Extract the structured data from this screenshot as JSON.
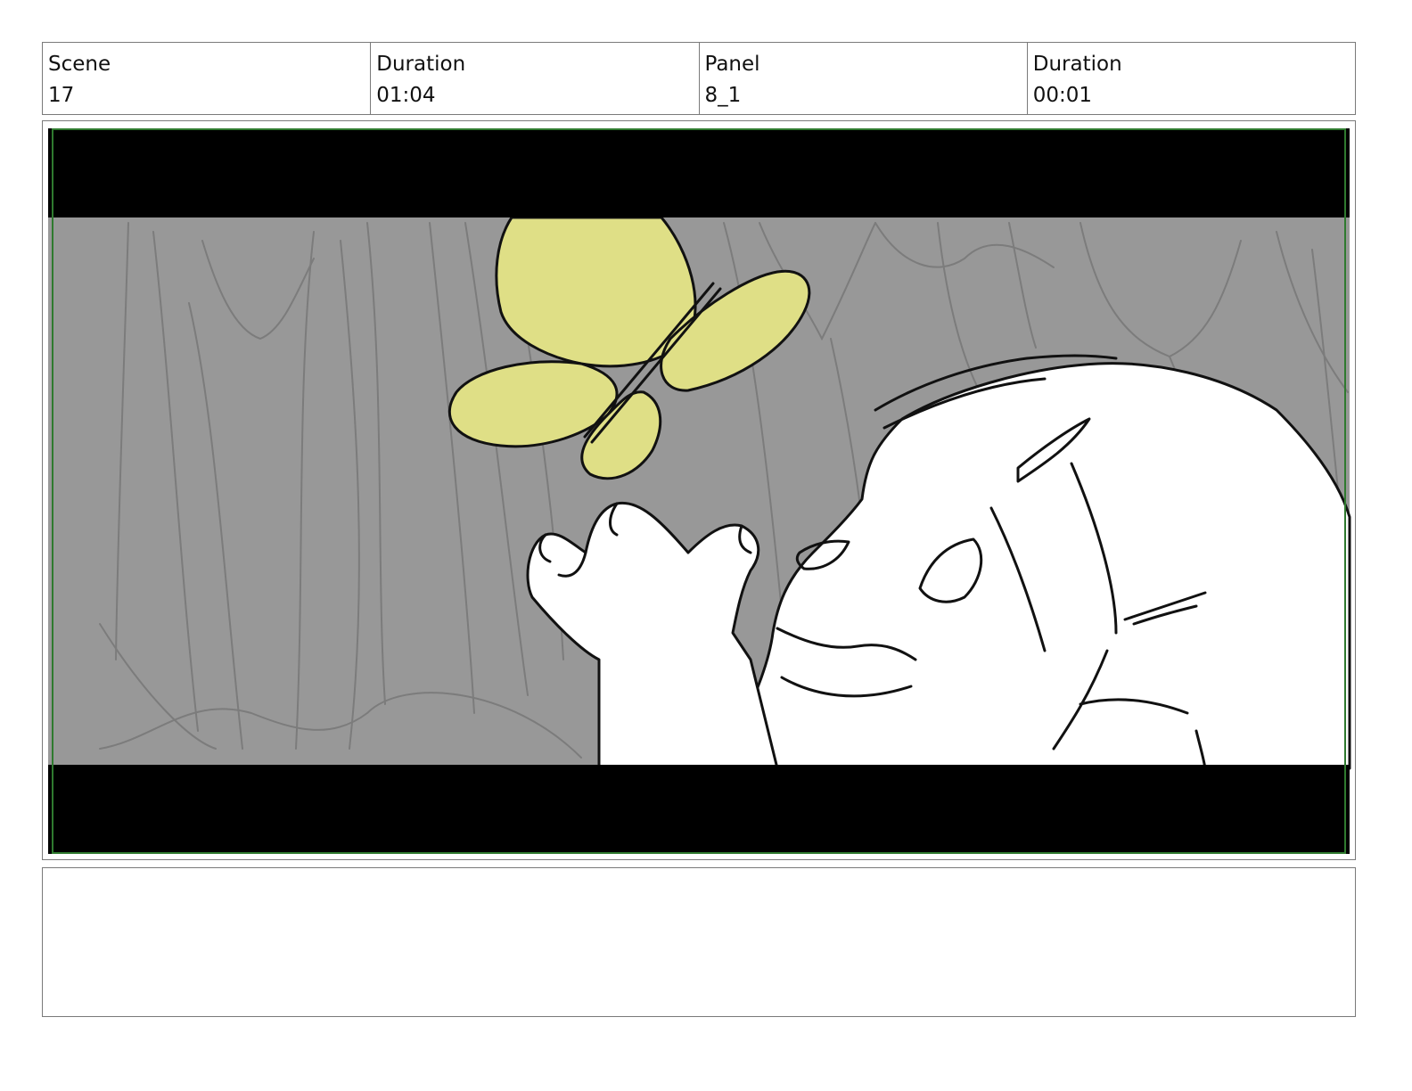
{
  "header": {
    "scene": {
      "label": "Scene",
      "value": "17"
    },
    "scene_duration": {
      "label": "Duration",
      "value": "01:04"
    },
    "panel": {
      "label": "Panel",
      "value": "8_1"
    },
    "panel_duration": {
      "label": "Duration",
      "value": "00:01"
    }
  },
  "frame": {
    "background_color": "#989898",
    "letterbox_color": "#000000",
    "safe_frame_color": "#2f7a2f",
    "butterfly_color": "#dfdf86",
    "character_color": "#ffffff"
  },
  "notes": {
    "text": ""
  }
}
